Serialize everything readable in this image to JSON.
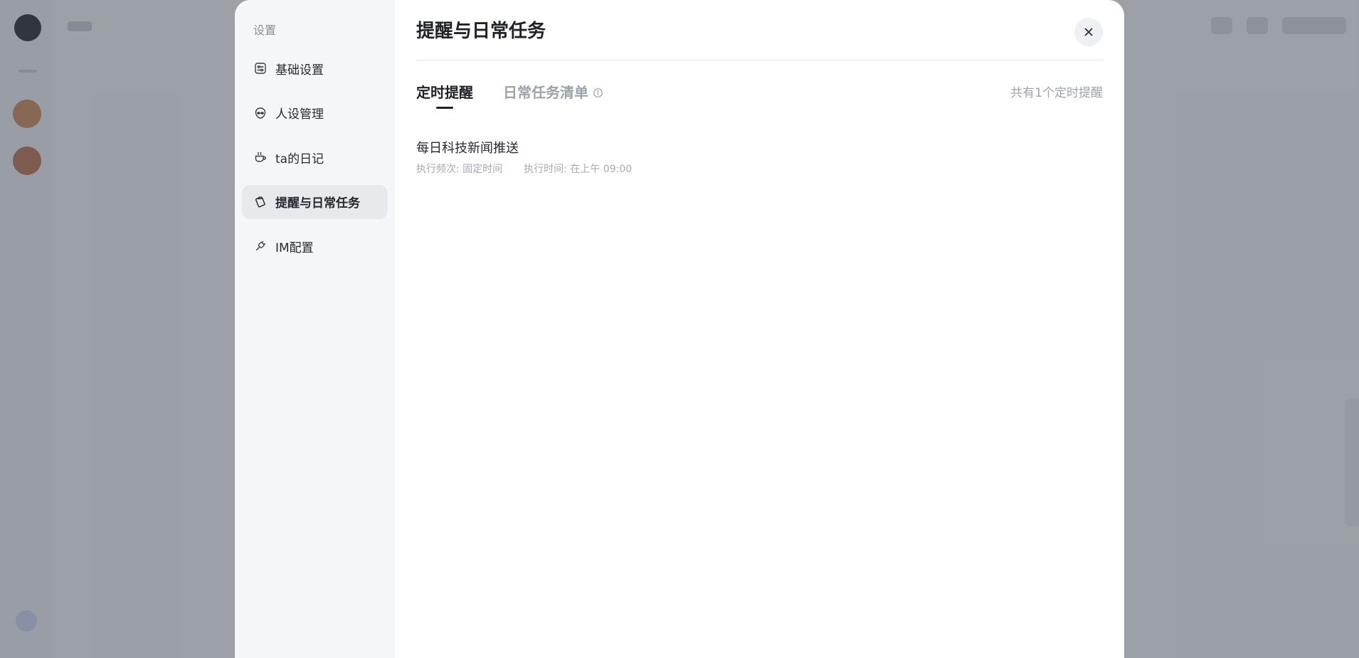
{
  "colors": {
    "overlay": "#373e4b",
    "modal_bg": "#ffffff",
    "sidebar_bg": "#f5f6f8",
    "active_item_bg": "#e7e9ed",
    "primary_text": "#1f2228",
    "muted_text": "#9ea3ab"
  },
  "sidebar": {
    "heading": "设置",
    "items": [
      {
        "label": "基础设置",
        "icon": "sliders-icon",
        "active": false
      },
      {
        "label": "人设管理",
        "icon": "alien-face-icon",
        "active": false
      },
      {
        "label": "ta的日记",
        "icon": "coffee-cup-icon",
        "active": false
      },
      {
        "label": "提醒与日常任务",
        "icon": "clipboard-icon",
        "active": true
      },
      {
        "label": "IM配置",
        "icon": "plug-icon",
        "active": false
      }
    ]
  },
  "main": {
    "title": "提醒与日常任务",
    "close_icon": "close-icon",
    "tabs": [
      {
        "label": "定时提醒",
        "active": true
      },
      {
        "label": "日常任务清单",
        "active": false,
        "icon": "info-icon"
      }
    ],
    "count_text": "共有1个定时提醒",
    "tasks": [
      {
        "title": "每日科技新闻推送",
        "frequency": "执行频次: 固定时间",
        "time": "执行时间: 在上午 09:00"
      }
    ]
  }
}
